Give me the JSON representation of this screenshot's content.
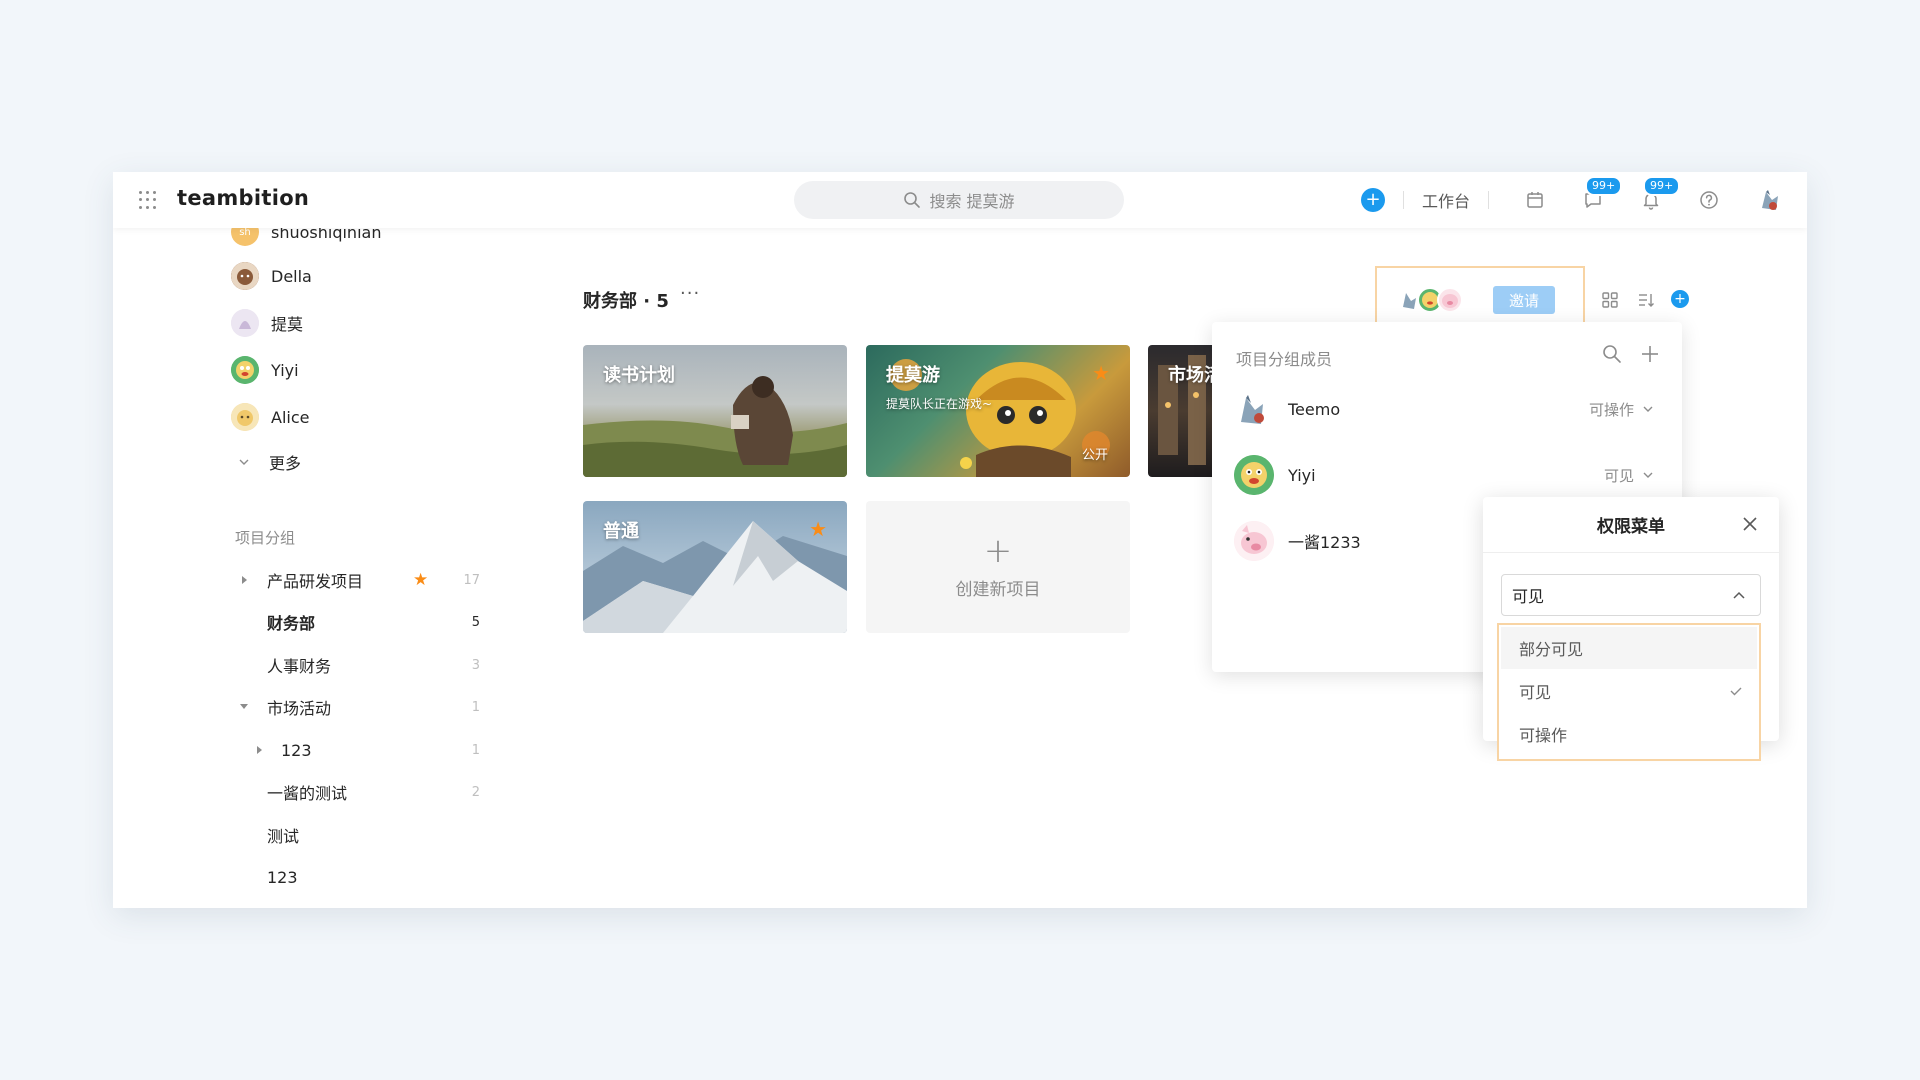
{
  "app": {
    "logo": "teambition"
  },
  "search": {
    "placeholder": "搜索 提莫游"
  },
  "header": {
    "workbench_label": "工作台",
    "badge_messages": "99+",
    "badge_notifications": "99+"
  },
  "sidebar": {
    "members": [
      {
        "name": "shuoshiqinian",
        "avatar_text": "sh",
        "color": "#f5c26b"
      },
      {
        "name": "Della",
        "avatar_text": "",
        "color": "#9b6b4a"
      },
      {
        "name": "提莫",
        "avatar_text": "",
        "color": "#c9b8d8"
      },
      {
        "name": "Yiyi",
        "avatar_text": "",
        "color": "#5ab56e"
      },
      {
        "name": "Alice",
        "avatar_text": "",
        "color": "#f0d49a"
      }
    ],
    "more_label": "更多",
    "group_title": "项目分组",
    "groups": [
      {
        "label": "产品研发项目",
        "count": "17",
        "starred": true,
        "expander": "right"
      },
      {
        "label": "财务部",
        "count": "5",
        "active": true
      },
      {
        "label": "人事财务",
        "count": "3"
      },
      {
        "label": "市场活动",
        "count": "1",
        "expander": "down"
      },
      {
        "label": "123",
        "count": "1",
        "expander": "right",
        "indent": true
      },
      {
        "label": "一酱的测试",
        "count": "2"
      },
      {
        "label": "测试",
        "count": ""
      },
      {
        "label": "123",
        "count": ""
      }
    ]
  },
  "section": {
    "title": "财务部 · 5",
    "more": "···"
  },
  "projects": [
    {
      "title": "读书计划",
      "subtitle": "",
      "starred": false,
      "public": ""
    },
    {
      "title": "提莫游",
      "subtitle": "提莫队长正在游戏~",
      "starred": true,
      "public": "公开"
    },
    {
      "title": "市场活动",
      "subtitle": "",
      "starred": false,
      "public": ""
    },
    {
      "title": "普通",
      "subtitle": "",
      "starred": true,
      "public": ""
    }
  ],
  "new_project_label": "创建新项目",
  "invite_label": "邀请",
  "members_popover": {
    "title": "项目分组成员",
    "members": [
      {
        "name": "Teemo",
        "permission": "可操作"
      },
      {
        "name": "Yiyi",
        "permission": "可见"
      },
      {
        "name": "一酱1233",
        "permission": ""
      }
    ]
  },
  "permission_menu": {
    "title": "权限菜单",
    "selected": "可见",
    "options": [
      {
        "label": "部分可见",
        "hover": true,
        "checked": false
      },
      {
        "label": "可见",
        "hover": false,
        "checked": true
      },
      {
        "label": "可操作",
        "hover": false,
        "checked": false
      }
    ]
  },
  "colors": {
    "accent": "#1b9aee",
    "star": "#fa8c16",
    "highlight": "#f8d4a4"
  }
}
